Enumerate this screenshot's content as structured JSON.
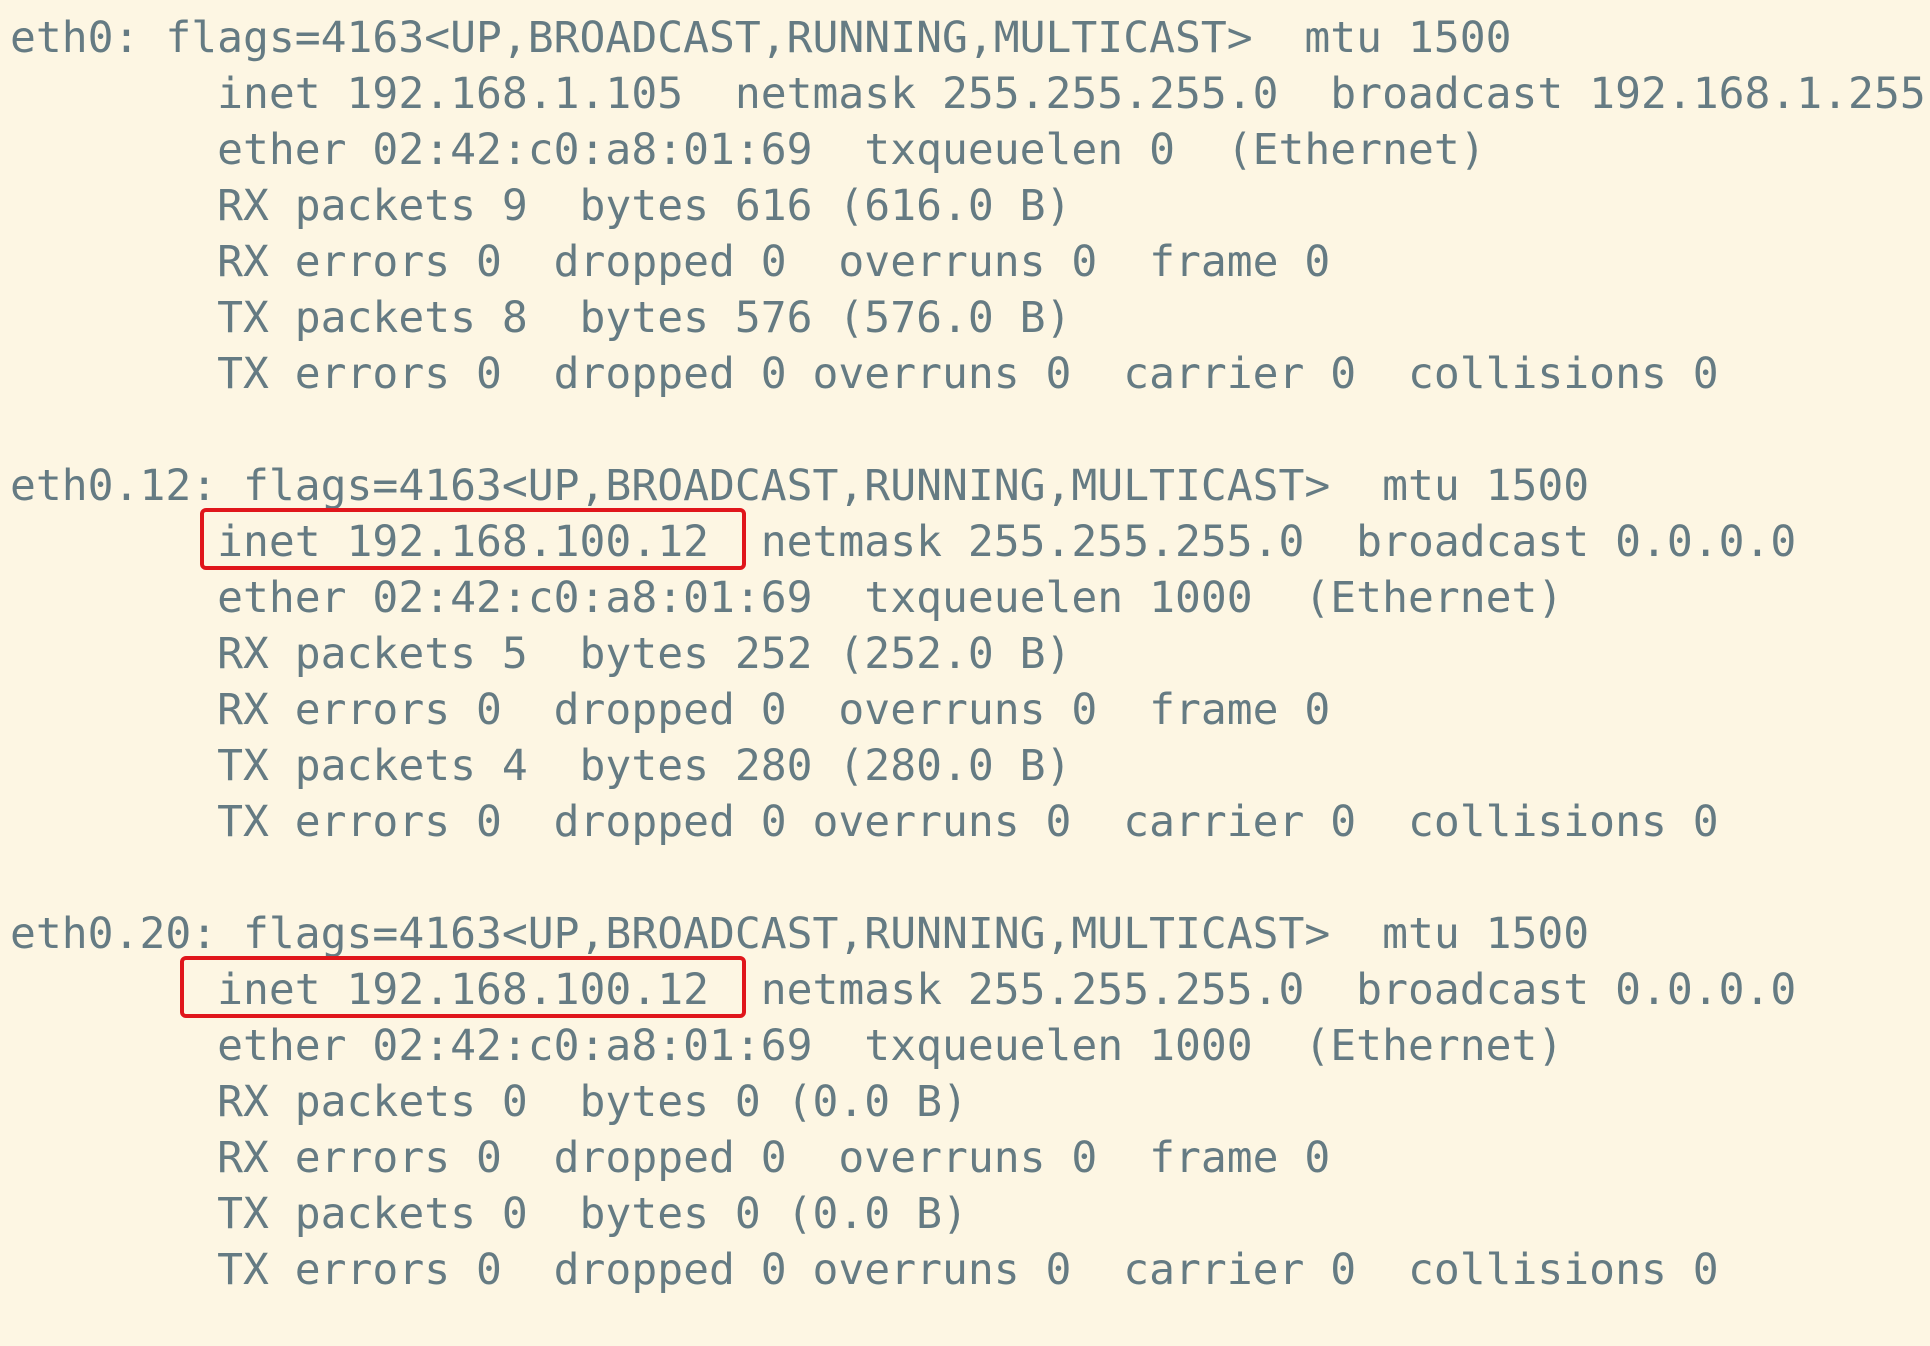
{
  "terminal": {
    "highlight_color": "#e0161b",
    "text_color": "#657b83",
    "background_color": "#fdf6e3",
    "lines": [
      "eth0: flags=4163<UP,BROADCAST,RUNNING,MULTICAST>  mtu 1500",
      "        inet 192.168.1.105  netmask 255.255.255.0  broadcast 192.168.1.255",
      "        ether 02:42:c0:a8:01:69  txqueuelen 0  (Ethernet)",
      "        RX packets 9  bytes 616 (616.0 B)",
      "        RX errors 0  dropped 0  overruns 0  frame 0",
      "        TX packets 8  bytes 576 (576.0 B)",
      "        TX errors 0  dropped 0 overruns 0  carrier 0  collisions 0",
      "",
      "eth0.12: flags=4163<UP,BROADCAST,RUNNING,MULTICAST>  mtu 1500",
      "        inet 192.168.100.12  netmask 255.255.255.0  broadcast 0.0.0.0",
      "        ether 02:42:c0:a8:01:69  txqueuelen 1000  (Ethernet)",
      "        RX packets 5  bytes 252 (252.0 B)",
      "        RX errors 0  dropped 0  overruns 0  frame 0",
      "        TX packets 4  bytes 280 (280.0 B)",
      "        TX errors 0  dropped 0 overruns 0  carrier 0  collisions 0",
      "",
      "eth0.20: flags=4163<UP,BROADCAST,RUNNING,MULTICAST>  mtu 1500",
      "        inet 192.168.100.12  netmask 255.255.255.0  broadcast 0.0.0.0",
      "        ether 02:42:c0:a8:01:69  txqueuelen 1000  (Ethernet)",
      "        RX packets 0  bytes 0 (0.0 B)",
      "        RX errors 0  dropped 0  overruns 0  frame 0",
      "        TX packets 0  bytes 0 (0.0 B)",
      "        TX errors 0  dropped 0 overruns 0  carrier 0  collisions 0"
    ]
  }
}
